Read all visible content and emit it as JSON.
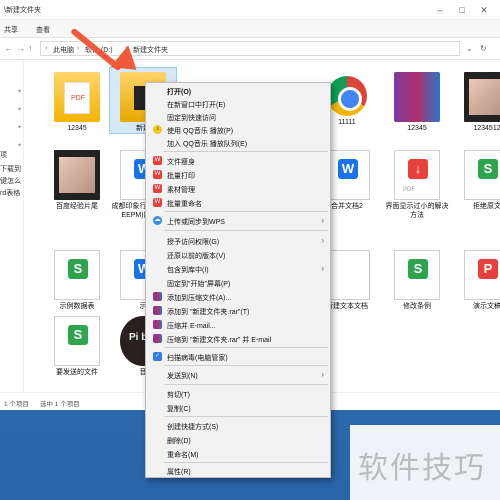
{
  "window": {
    "title": "\\新建文件夹"
  },
  "ribbon": {
    "tabs": [
      "共享",
      "查看"
    ]
  },
  "address": {
    "crumbs": [
      "此电脑",
      "软件 (D:)",
      "新建文件夹"
    ]
  },
  "sidebar": {
    "items": [
      "项",
      "下载到",
      "键怎么",
      "rd表格"
    ],
    "pinned": [
      "✦",
      "✦",
      "✦",
      "✦"
    ]
  },
  "status": {
    "count": "1 个项目",
    "selection": "选中 1 个项目"
  },
  "files": {
    "row1": [
      "12345",
      "新建",
      "",
      "",
      "11111",
      "12345",
      "1234512"
    ],
    "row2": [
      "百度经验片尾",
      "成都印象行颁发宣传EEPM)能够获",
      "",
      "",
      "合并文档2",
      "界面显示过小的解决方法",
      "拒绝原文"
    ],
    "row3": [
      "示例数据表",
      "示",
      "",
      "",
      "新建文本文档",
      "修改条例",
      "演示文稿"
    ],
    "row4": [
      "要发送的文件",
      "音",
      "",
      "",
      "",
      "",
      ""
    ]
  },
  "thumb_labels": {
    "pdf": "PDF",
    "pdf_lower": "PDF",
    "word": "W",
    "sheet": "S",
    "dark": "Pi bc"
  },
  "context_menu": {
    "items": [
      {
        "label": "打开(O)",
        "bold": true
      },
      {
        "label": "在新窗口中打开(E)"
      },
      {
        "label": "固定到快速访问"
      },
      {
        "label": "使用 QQ音乐 播放(P)",
        "icon": "qq-music-icon"
      },
      {
        "label": "加入 QQ音乐 播放队列(E)"
      },
      {
        "label": "文件瘦身",
        "icon": "wps-icon"
      },
      {
        "label": "批量打印",
        "icon": "wps-icon"
      },
      {
        "label": "素材管理",
        "icon": "wps-icon"
      },
      {
        "label": "批量重命名",
        "icon": "wps-icon"
      },
      {
        "label": "上传或同步到WPS",
        "icon": "cloud-icon",
        "submenu": true
      },
      {
        "label": "授予访问权限(G)",
        "submenu": true
      },
      {
        "label": "还原以前的版本(V)"
      },
      {
        "label": "包含到库中(I)",
        "submenu": true
      },
      {
        "label": "固定到\"开始\"屏幕(P)"
      },
      {
        "label": "添加到压缩文件(A)...",
        "icon": "winrar-icon"
      },
      {
        "label": "添加到 \"新建文件夹.rar\"(T)",
        "icon": "winrar-icon"
      },
      {
        "label": "压缩并 E-mail...",
        "icon": "winrar-icon"
      },
      {
        "label": "压缩到 \"新建文件夹.rar\" 并 E-mail",
        "icon": "winrar-icon"
      },
      {
        "label": "扫描病毒(电脑管家)",
        "icon": "shield-icon"
      },
      {
        "label": "发送到(N)",
        "submenu": true
      },
      {
        "label": "剪切(T)"
      },
      {
        "label": "复制(C)"
      },
      {
        "label": "创建快捷方式(S)"
      },
      {
        "label": "删除(D)"
      },
      {
        "label": "重命名(M)"
      },
      {
        "label": "属性(R)"
      }
    ]
  },
  "watermark": {
    "text": "软件技巧"
  },
  "colors": {
    "accent": "#1979ca",
    "arrow": "#ef5a3a",
    "wps": "#e8403a",
    "word": "#1a73e8",
    "sheet": "#2ea44f"
  }
}
